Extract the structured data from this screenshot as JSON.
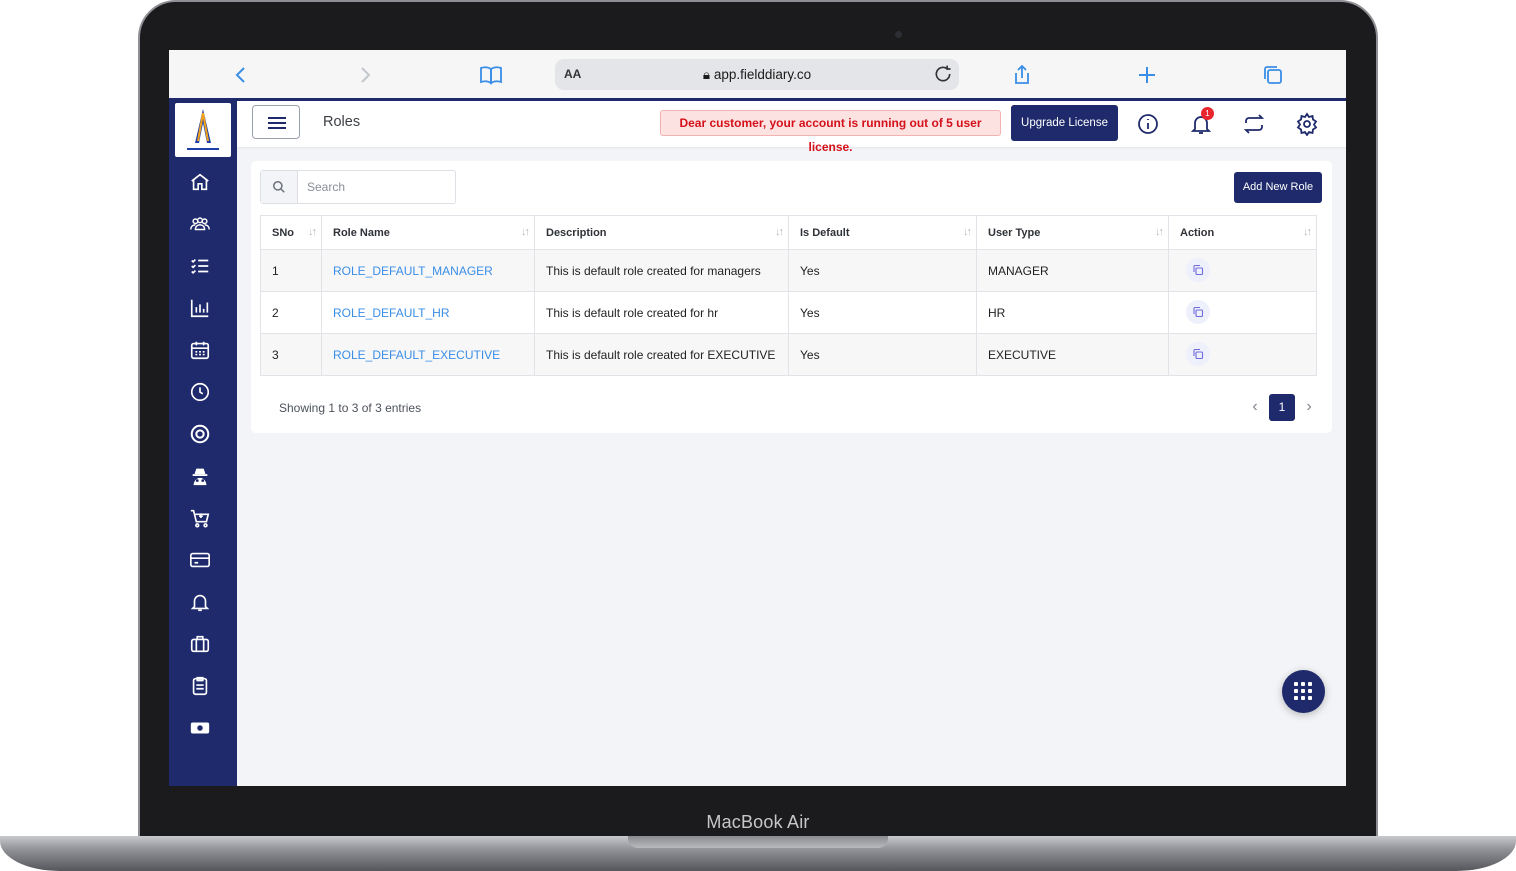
{
  "device": {
    "label": "MacBook Air"
  },
  "browser": {
    "text_size_label": "AA",
    "url": "app.fielddiary.co"
  },
  "sidebar": {
    "items": [
      {
        "icon": "home-icon"
      },
      {
        "icon": "users-icon"
      },
      {
        "icon": "task-list-icon"
      },
      {
        "icon": "bar-chart-icon"
      },
      {
        "icon": "calendar-icon"
      },
      {
        "icon": "clock-icon"
      },
      {
        "icon": "target-icon"
      },
      {
        "icon": "spy-icon"
      },
      {
        "icon": "cart-icon"
      },
      {
        "icon": "card-icon"
      },
      {
        "icon": "bell-icon"
      },
      {
        "icon": "briefcase-icon"
      },
      {
        "icon": "clipboard-icon"
      },
      {
        "icon": "cash-icon"
      }
    ]
  },
  "header": {
    "title": "Roles",
    "alert": "Dear customer, your account is running out of 5 user license.",
    "upgrade_label": "Upgrade License",
    "notification_count": "1"
  },
  "content": {
    "search_placeholder": "Search",
    "add_button": "Add New Role",
    "columns": [
      "SNo",
      "Role Name",
      "Description",
      "Is Default",
      "User Type",
      "Action"
    ],
    "rows": [
      {
        "sno": "1",
        "role": "ROLE_DEFAULT_MANAGER",
        "description": "This is default role created for managers",
        "is_default": "Yes",
        "user_type": "MANAGER"
      },
      {
        "sno": "2",
        "role": "ROLE_DEFAULT_HR",
        "description": "This is default role created for hr",
        "is_default": "Yes",
        "user_type": "HR"
      },
      {
        "sno": "3",
        "role": "ROLE_DEFAULT_EXECUTIVE",
        "description": "This is default role created for EXECUTIVE",
        "is_default": "Yes",
        "user_type": "EXECUTIVE"
      }
    ],
    "entries_info": "Showing 1 to 3 of 3 entries",
    "current_page": "1"
  },
  "colors": {
    "primary": "#1e2a6b",
    "link": "#3a8ee6",
    "alert": "#d4111a"
  }
}
